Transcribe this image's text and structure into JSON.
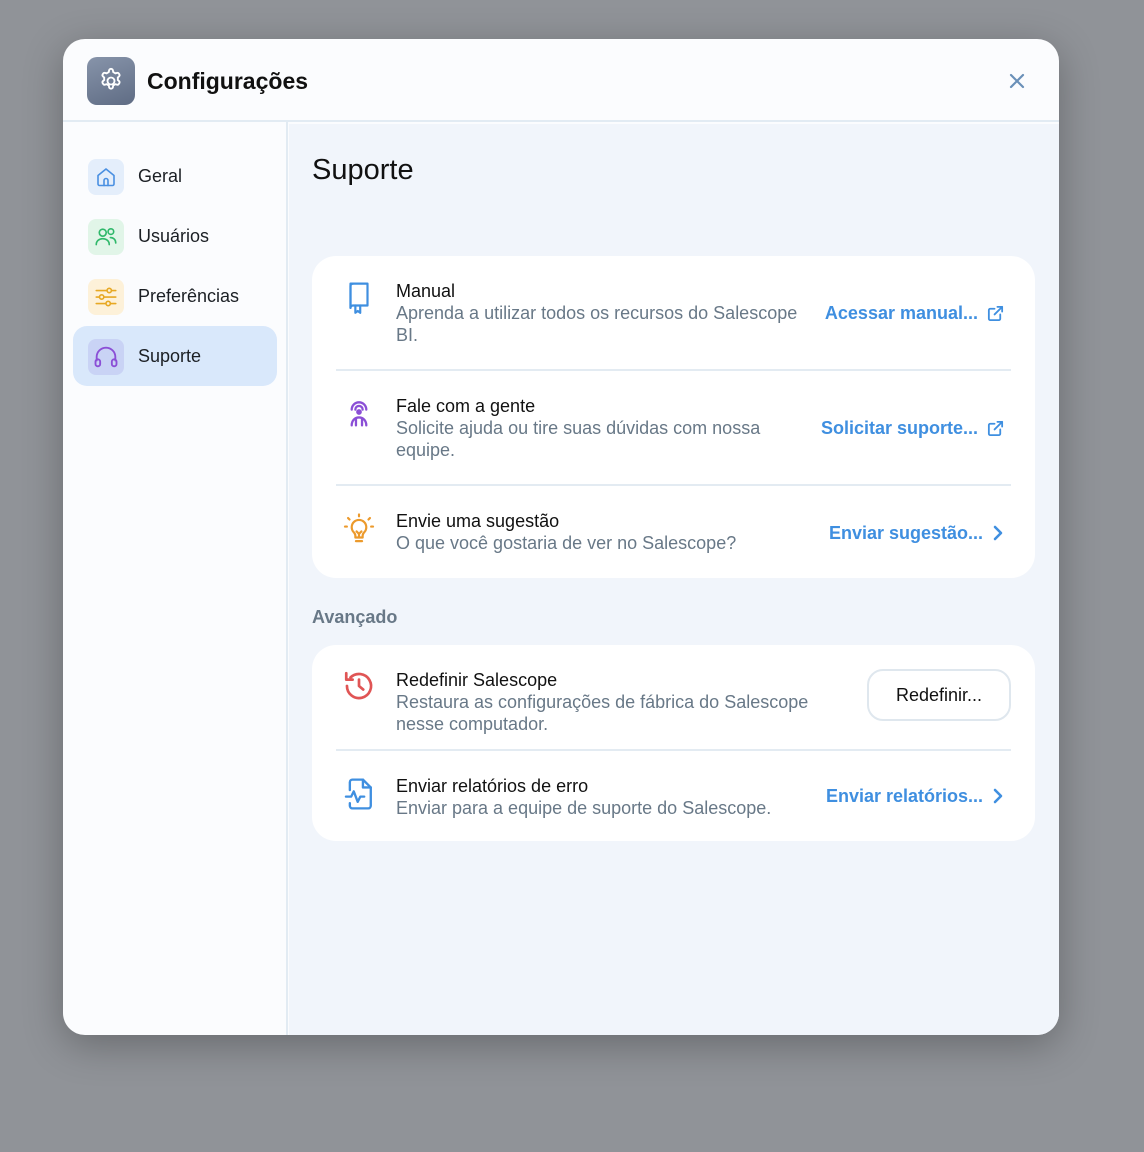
{
  "header": {
    "title": "Configurações",
    "icon": "gear-icon",
    "close_icon": "close-icon"
  },
  "sidebar": {
    "items": [
      {
        "label": "Geral",
        "icon": "home-icon",
        "color": "#4a90e2",
        "bg": "#e4eefb"
      },
      {
        "label": "Usuários",
        "icon": "users-icon",
        "color": "#2fb86a",
        "bg": "#e1f5e8"
      },
      {
        "label": "Preferências",
        "icon": "sliders-icon",
        "color": "#e7a823",
        "bg": "#fdf1d9"
      },
      {
        "label": "Suporte",
        "icon": "headphones-icon",
        "color": "#8b4fd6",
        "bg": "#c9d3f5",
        "active": true
      }
    ]
  },
  "main": {
    "title": "Suporte",
    "support_rows": [
      {
        "title": "Manual",
        "desc": "Aprenda a utilizar todos os recursos do Salescope BI.",
        "link": "Acessar manual...",
        "icon": "book-icon",
        "link_icon": "external-link-icon"
      },
      {
        "title": "Fale com a gente",
        "desc": "Solicite ajuda ou tire suas dúvidas com nossa equipe.",
        "link": "Solicitar suporte...",
        "icon": "support-agent-icon",
        "link_icon": "external-link-icon"
      },
      {
        "title": "Envie uma sugestão",
        "desc": "O que você gostaria de ver no Salescope?",
        "link": "Enviar sugestão...",
        "icon": "lightbulb-icon",
        "link_icon": "chevron-right-icon"
      }
    ],
    "advanced_label": "Avançado",
    "advanced_rows": [
      {
        "title": "Redefinir Salescope",
        "desc": "Restaura as configurações de fábrica do Salescope nesse computador.",
        "button": "Redefinir...",
        "icon": "history-icon"
      },
      {
        "title": "Enviar relatórios de erro",
        "desc": "Enviar para a equipe de suporte do Salescope.",
        "link": "Enviar relatórios...",
        "icon": "file-activity-icon",
        "link_icon": "chevron-right-icon"
      }
    ]
  },
  "colors": {
    "accent": "#3f8fe0",
    "muted_text": "#687887",
    "reset_icon": "#e05555",
    "suggest_icon": "#ec9a2c",
    "support_icon": "#8b4fd6"
  }
}
